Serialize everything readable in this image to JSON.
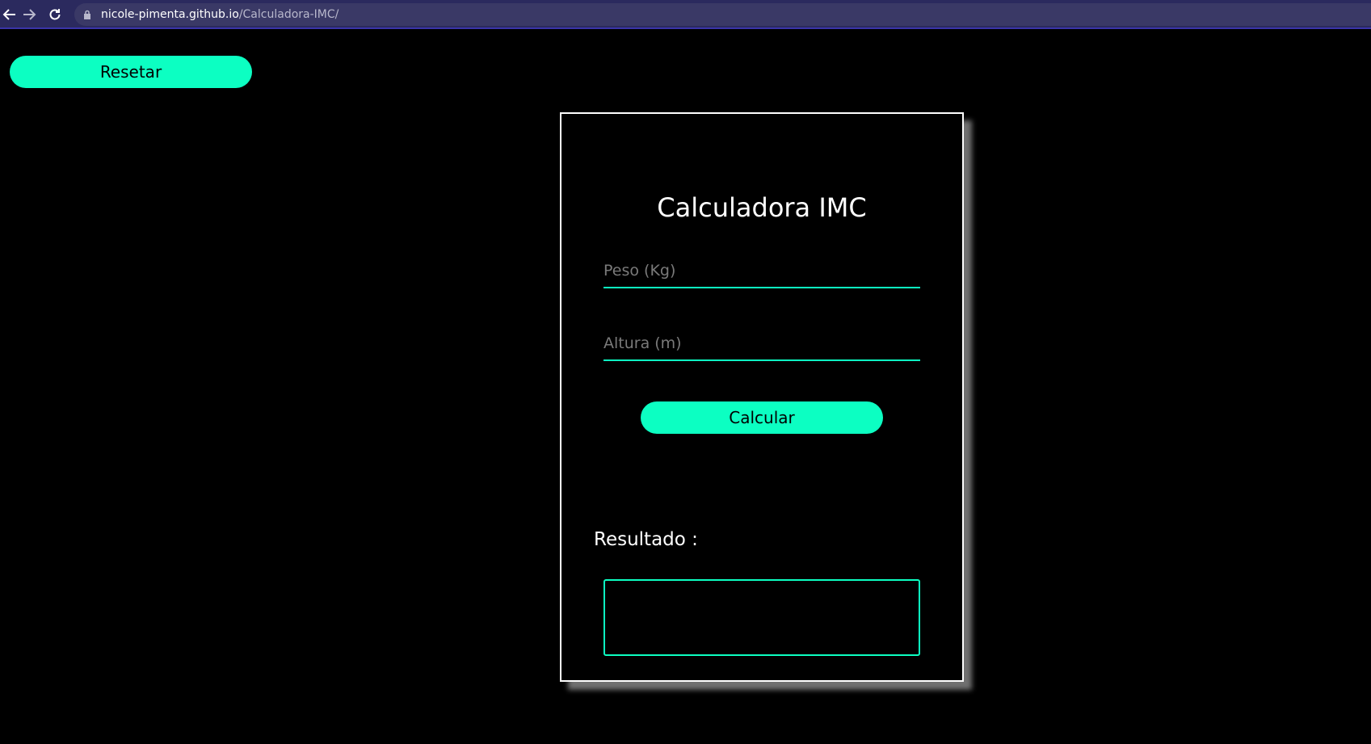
{
  "browser": {
    "url_host": "nicole-pimenta.github.io",
    "url_path": "/Calculadora-IMC/",
    "icons": [
      "back-icon",
      "forward-icon",
      "reload-icon",
      "lock-icon"
    ]
  },
  "page": {
    "reset_label": "Resetar"
  },
  "card": {
    "title": "Calculadora IMC",
    "peso_placeholder": "Peso (Kg)",
    "altura_placeholder": "Altura (m)",
    "calc_label": "Calcular",
    "result_label": "Resultado :",
    "result_value": ""
  },
  "colors": {
    "accent": "#0cffc2",
    "background": "#000000",
    "card_border": "#ffffff",
    "browser_bar": "#2b2a5e"
  }
}
